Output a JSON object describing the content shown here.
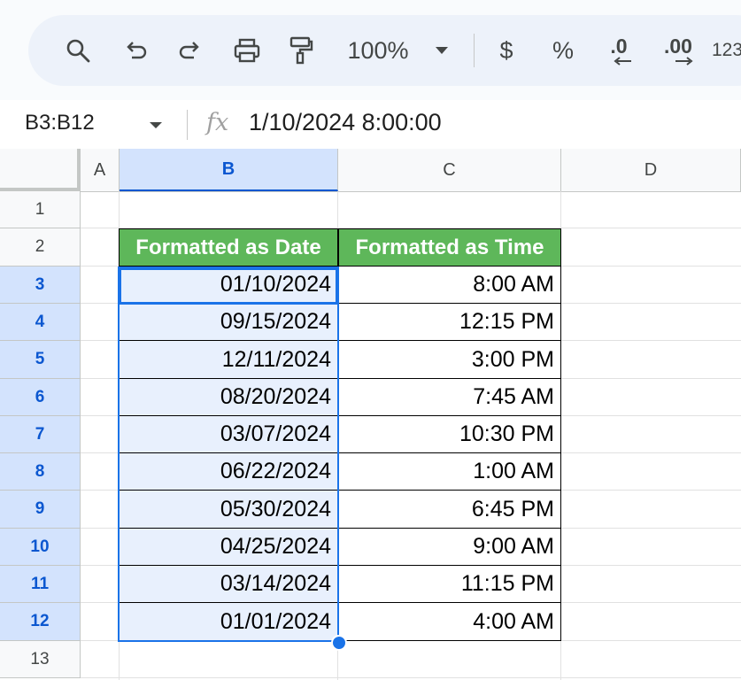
{
  "toolbar": {
    "zoom": "100%",
    "currency": "$",
    "percent": "%",
    "dec_decrease": ".0",
    "dec_increase": ".00",
    "more_formats": "123"
  },
  "formula_bar": {
    "name_box": "B3:B12",
    "fx_label": "fx",
    "value": "1/10/2024 8:00:00"
  },
  "sheet": {
    "columns": [
      "A",
      "B",
      "C",
      "D"
    ],
    "rows": [
      "1",
      "2",
      "3",
      "4",
      "5",
      "6",
      "7",
      "8",
      "9",
      "10",
      "11",
      "12",
      "13"
    ],
    "headers": {
      "b": "Formatted as Date",
      "c": "Formatted as Time"
    },
    "data": [
      {
        "date": "01/10/2024",
        "time": "8:00 AM"
      },
      {
        "date": "09/15/2024",
        "time": "12:15 PM"
      },
      {
        "date": "12/11/2024",
        "time": "3:00 PM"
      },
      {
        "date": "08/20/2024",
        "time": "7:45 AM"
      },
      {
        "date": "03/07/2024",
        "time": "10:30 PM"
      },
      {
        "date": "06/22/2024",
        "time": "1:00 AM"
      },
      {
        "date": "05/30/2024",
        "time": "6:45 PM"
      },
      {
        "date": "04/25/2024",
        "time": "9:00 AM"
      },
      {
        "date": "03/14/2024",
        "time": "11:15 PM"
      },
      {
        "date": "01/01/2024",
        "time": "4:00 AM"
      }
    ]
  },
  "colors": {
    "header_green": "#5eb75a",
    "selection_blue": "#1a73e8",
    "selected_fill": "#e8f0fd"
  }
}
